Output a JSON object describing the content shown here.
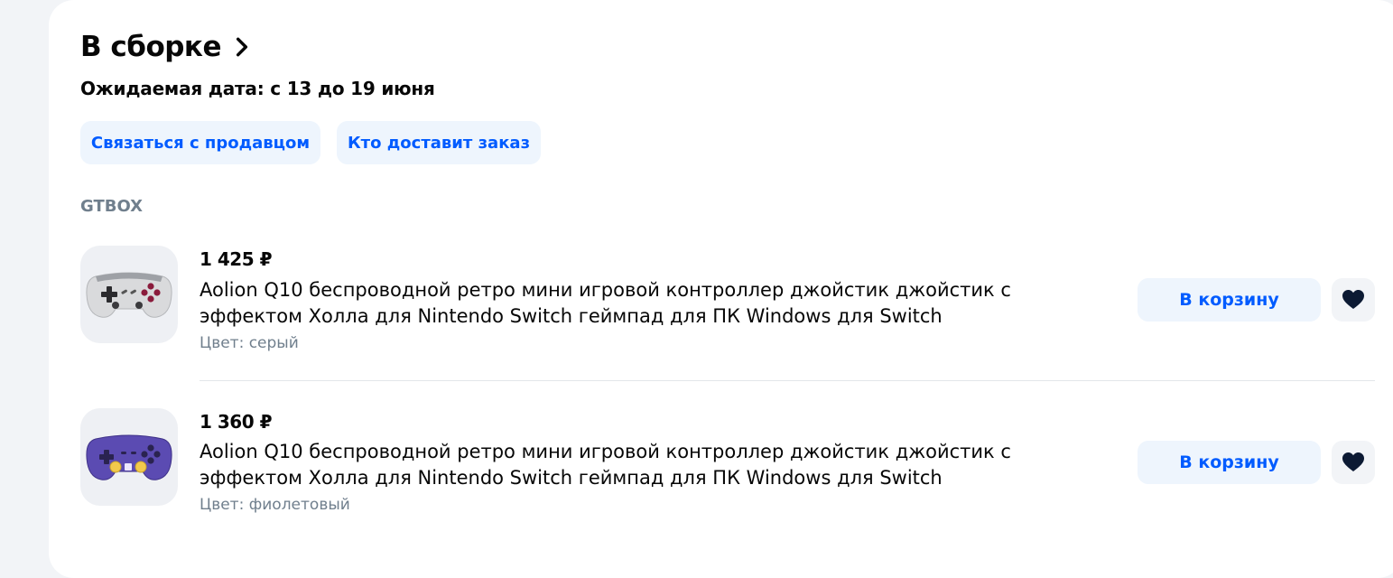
{
  "section": {
    "title": "В сборке",
    "expected_date": "Ожидаемая дата: с 13 до 19 июня"
  },
  "actions": {
    "contact_seller": "Связаться с продавцом",
    "who_delivers": "Кто доставит заказ"
  },
  "seller": "GTBOX",
  "items": [
    {
      "price": "1 425 ₽",
      "name": "Aolion Q10 беспроводной ретро мини игровой контроллер джойстик джойстик с эффектом Холла для Nintendo Switch геймпад для ПК Windows для Switch",
      "color": "Цвет: серый",
      "cart_label": "В корзину",
      "image_icon": "gamepad-gray-icon"
    },
    {
      "price": "1 360 ₽",
      "name": "Aolion Q10 беспроводной ретро мини игровой контроллер джойстик джойстик с эффектом Холла для Nintendo Switch геймпад для ПК Windows для Switch",
      "color": "Цвет: фиолетовый",
      "cart_label": "В корзину",
      "image_icon": "gamepad-purple-icon"
    }
  ],
  "colors": {
    "accent": "#005bff",
    "button_bg": "#eef5fd",
    "muted_text": "#707f8d",
    "page_bg": "#f2f4f7"
  }
}
